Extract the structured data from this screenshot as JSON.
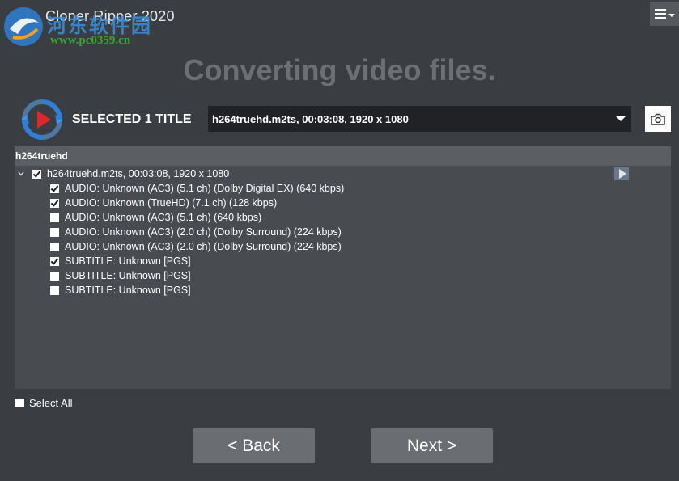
{
  "app": {
    "title": "Cloner Ripper 2020",
    "watermark_cn": "河东软件园",
    "watermark_url": "www.pc0359.cn"
  },
  "heading": "Converting video files.",
  "selection": {
    "label": "SELECTED 1 TITLE",
    "selected_title": "h264truehd.m2ts, 00:03:08, 1920 x 1080"
  },
  "tree": {
    "header": "h264truehd",
    "root": {
      "label": "h264truehd.m2ts, 00:03:08, 1920 x 1080",
      "checked": true
    },
    "tracks": [
      {
        "label": "AUDIO: Unknown (AC3) (5.1 ch) (Dolby Digital EX) (640 kbps)",
        "checked": true
      },
      {
        "label": "AUDIO: Unknown (TrueHD) (7.1 ch) (128 kbps)",
        "checked": true
      },
      {
        "label": "AUDIO: Unknown (AC3) (5.1 ch) (640 kbps)",
        "checked": false
      },
      {
        "label": "AUDIO: Unknown (AC3) (2.0 ch) (Dolby Surround) (224 kbps)",
        "checked": false
      },
      {
        "label": "AUDIO: Unknown (AC3) (2.0 ch) (Dolby Surround) (224 kbps)",
        "checked": false
      },
      {
        "label": "SUBTITLE: Unknown [PGS]",
        "checked": true
      },
      {
        "label": "SUBTITLE: Unknown [PGS]",
        "checked": false
      },
      {
        "label": "SUBTITLE: Unknown [PGS]",
        "checked": false
      }
    ]
  },
  "select_all": {
    "label": "Select All",
    "checked": false
  },
  "nav": {
    "back_label": "<  Back",
    "next_label": "Next  >"
  },
  "colors": {
    "background": "#3a3d41",
    "panel": "#484b50",
    "button": "#6a6d71",
    "brand_red": "#e0262b",
    "brand_blue": "#2f7fd6"
  }
}
